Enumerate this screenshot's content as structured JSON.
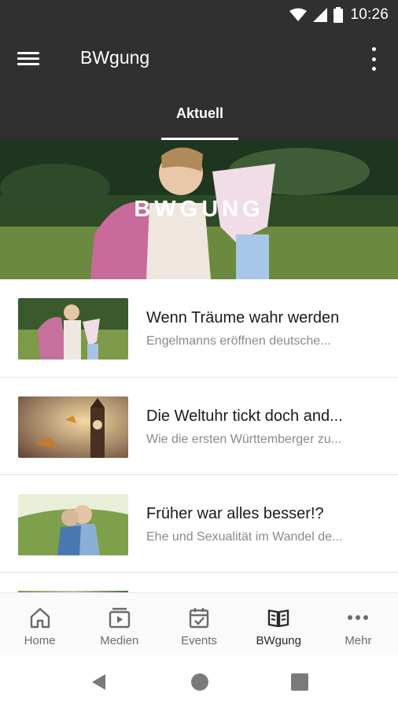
{
  "status_bar": {
    "time": "10:26"
  },
  "app_bar": {
    "title": "BWgung"
  },
  "tabs": [
    {
      "label": "Aktuell",
      "active": true
    }
  ],
  "hero": {
    "title": "BWGUNG"
  },
  "articles": [
    {
      "title": "Wenn Träume wahr werden",
      "subtitle": "Engelmanns eröffnen deutsche..."
    },
    {
      "title": "Die Weltuhr tickt doch and...",
      "subtitle": "Wie die ersten Württemberger zu..."
    },
    {
      "title": "Früher war alles besser!?",
      "subtitle": "Ehe und Sexualität im Wandel de..."
    }
  ],
  "bottom_nav": [
    {
      "label": "Home",
      "icon": "home-icon"
    },
    {
      "label": "Medien",
      "icon": "media-icon"
    },
    {
      "label": "Events",
      "icon": "calendar-icon"
    },
    {
      "label": "BWgung",
      "icon": "book-icon",
      "active": true
    },
    {
      "label": "Mehr",
      "icon": "more-icon"
    }
  ],
  "colors": {
    "app_bar": "#303030",
    "nav_bg": "#fafafa",
    "inactive": "#6b6b6b",
    "active": "#2a2a2a"
  }
}
